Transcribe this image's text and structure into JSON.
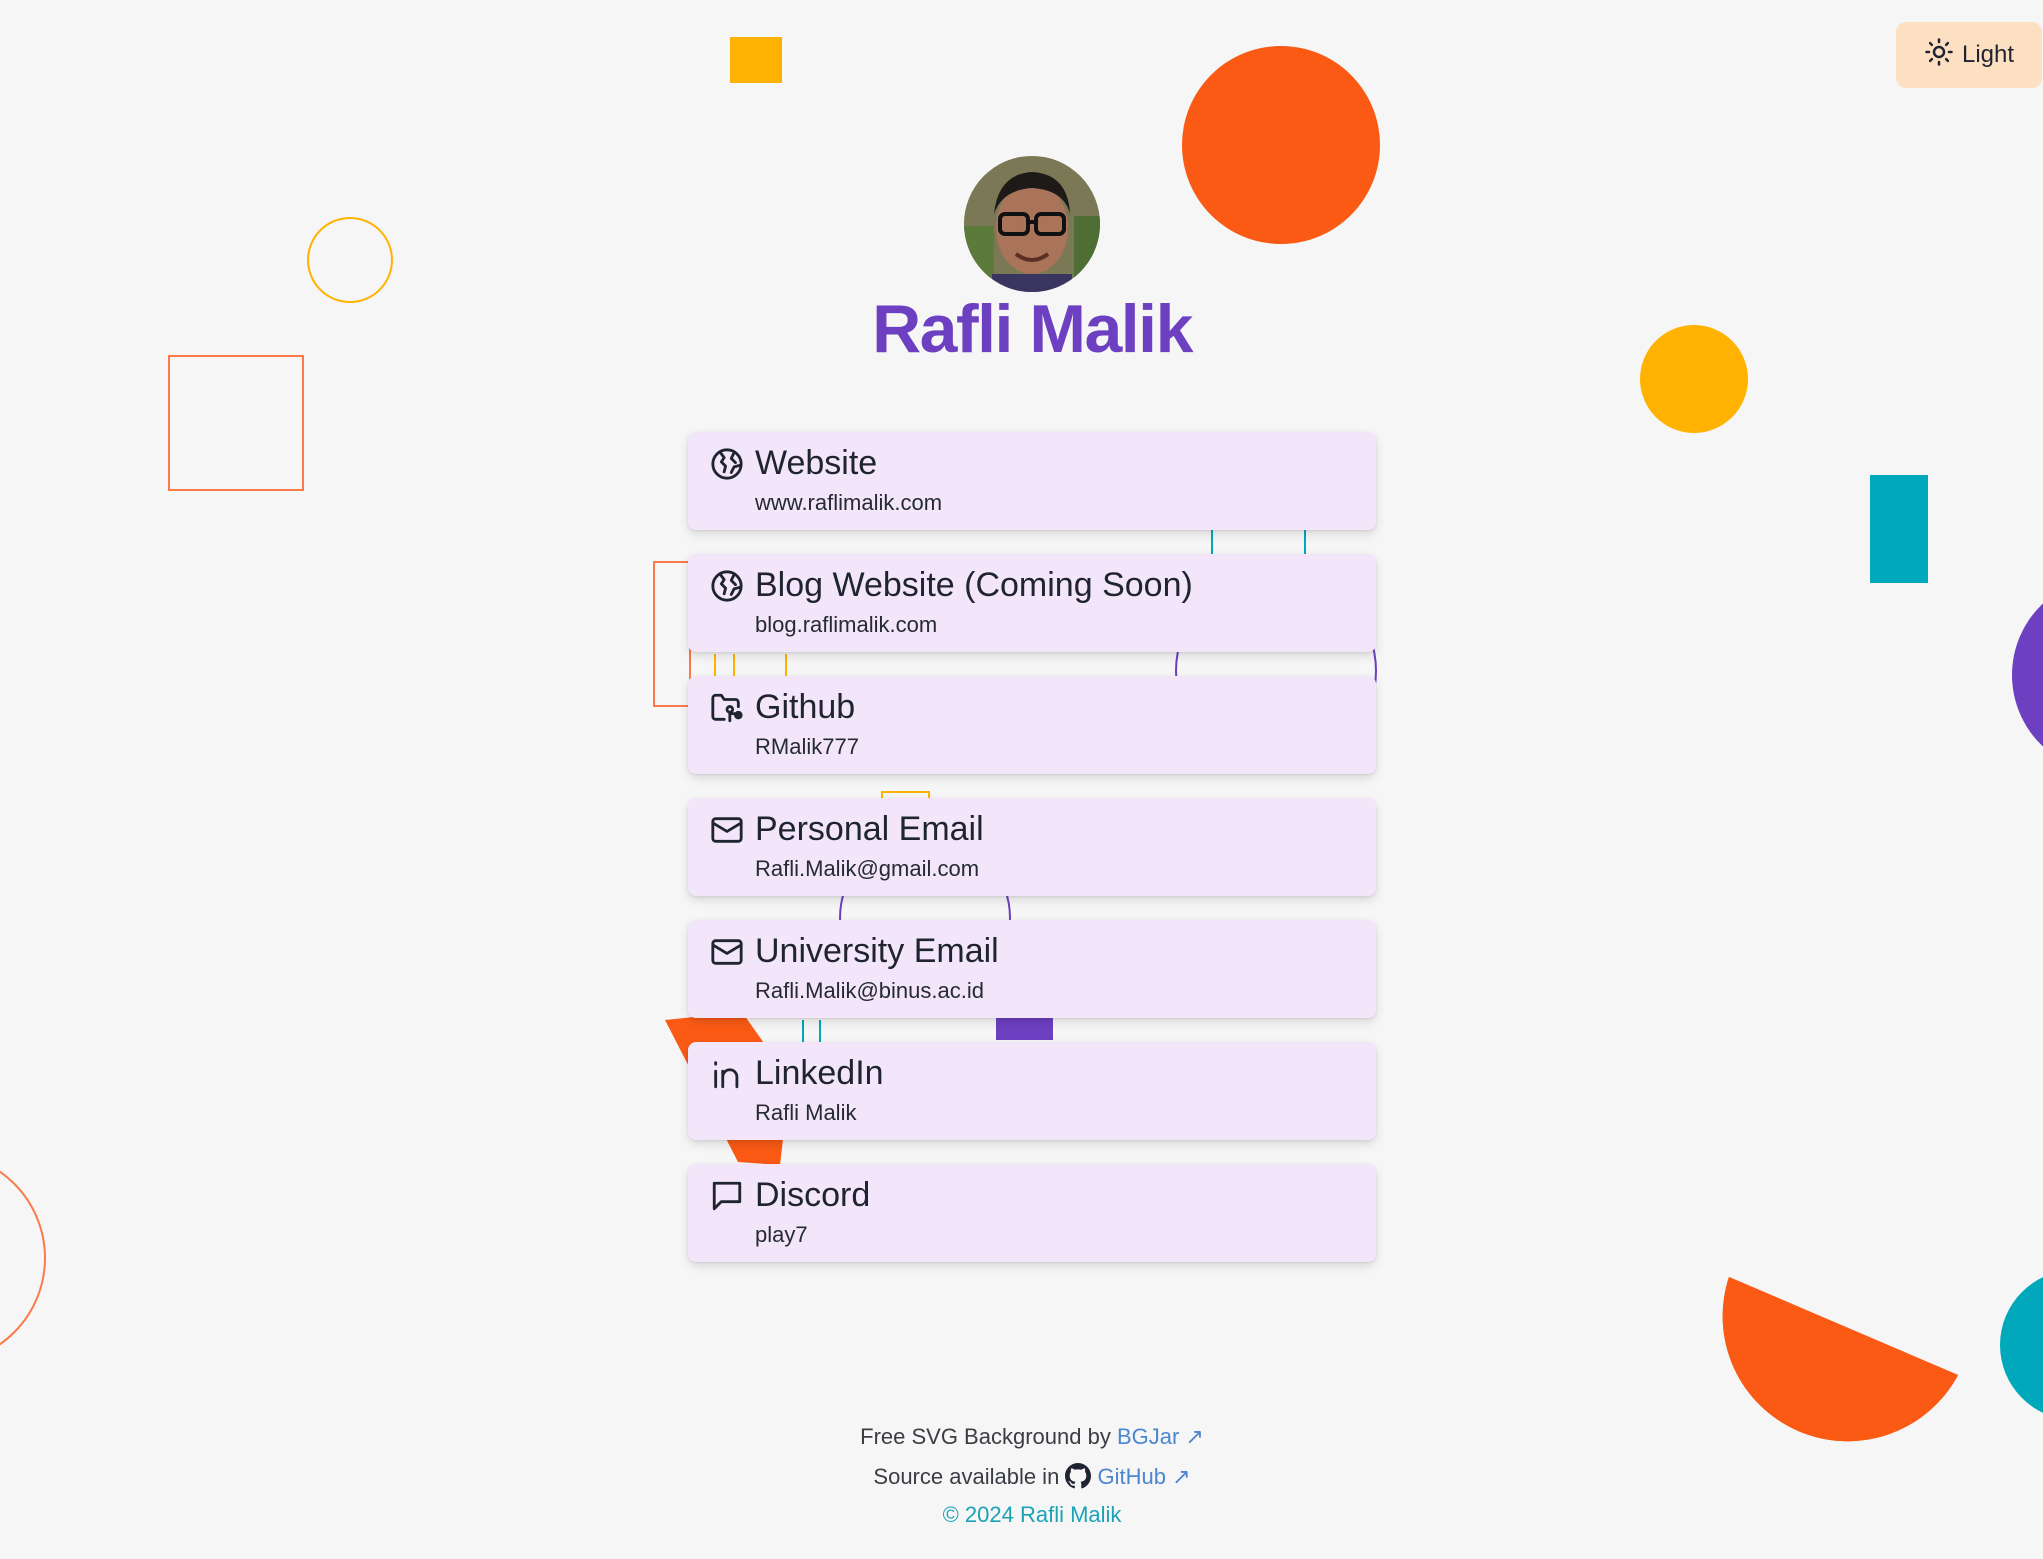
{
  "theme_toggle": {
    "label": "Light",
    "icon": "sun-icon"
  },
  "profile": {
    "name": "Rafli Malik",
    "avatar": "profile-photo"
  },
  "links": [
    {
      "icon": "globe-icon",
      "title": "Website",
      "subtitle": "www.raflimalik.com"
    },
    {
      "icon": "globe-icon",
      "title": "Blog Website (Coming Soon)",
      "subtitle": "blog.raflimalik.com"
    },
    {
      "icon": "github-folder-icon",
      "title": "Github",
      "subtitle": "RMalik777"
    },
    {
      "icon": "mail-icon",
      "title": "Personal Email",
      "subtitle": "Rafli.Malik@gmail.com"
    },
    {
      "icon": "mail-icon",
      "title": "University Email",
      "subtitle": "Rafli.Malik@binus.ac.id"
    },
    {
      "icon": "linkedin-icon",
      "title": "LinkedIn",
      "subtitle": "Rafli Malik"
    },
    {
      "icon": "chat-bubble-icon",
      "title": "Discord",
      "subtitle": "play7"
    }
  ],
  "footer": {
    "bg_prefix": "Free SVG Background by ",
    "bg_link": "BGJar",
    "source_prefix": "Source available in ",
    "source_link": "GitHub",
    "external_arrow": "↗",
    "copyright": "© 2024 Rafli Malik"
  },
  "colors": {
    "accent": "#6d3fc1",
    "card": "#f3e6fb",
    "orange": "#fa5a14",
    "yellow": "#ffb300",
    "teal": "#00a8bc",
    "link": "#4c86ce"
  }
}
